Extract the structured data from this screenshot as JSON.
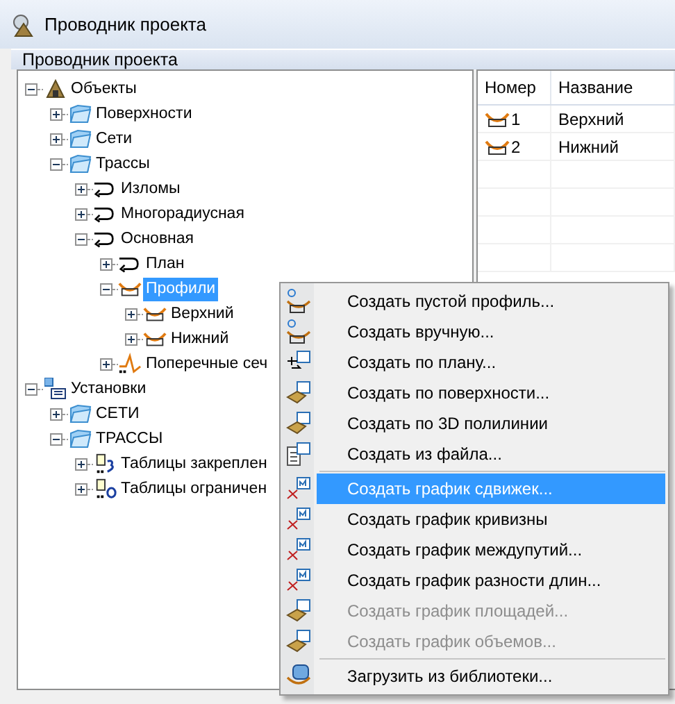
{
  "window": {
    "title": "Проводник проекта"
  },
  "panel_header": "Проводник проекта",
  "tree": [
    {
      "label": "Объекты",
      "kind": "root",
      "expanded": true,
      "selected": false,
      "children": [
        {
          "label": "Поверхности",
          "kind": "folder",
          "expanded": false,
          "selected": false
        },
        {
          "label": "Сети",
          "kind": "folder",
          "expanded": false,
          "selected": false
        },
        {
          "label": "Трассы",
          "kind": "folder",
          "expanded": true,
          "selected": false,
          "children": [
            {
              "label": "Изломы",
              "kind": "alignment",
              "expanded": false,
              "selected": false
            },
            {
              "label": "Многорадиусная",
              "kind": "alignment",
              "expanded": false,
              "selected": false
            },
            {
              "label": "Основная",
              "kind": "alignment",
              "expanded": true,
              "selected": false,
              "children": [
                {
                  "label": "План",
                  "kind": "alignment",
                  "expanded": false,
                  "selected": false
                },
                {
                  "label": "Профили",
                  "kind": "profile",
                  "expanded": true,
                  "selected": true,
                  "children": [
                    {
                      "label": "Верхний",
                      "kind": "profile",
                      "expanded": false,
                      "selected": false
                    },
                    {
                      "label": "Нижний",
                      "kind": "profile",
                      "expanded": false,
                      "selected": false
                    }
                  ]
                },
                {
                  "label": "Поперечные сеч",
                  "kind": "section",
                  "expanded": false,
                  "selected": false
                }
              ]
            }
          ]
        }
      ]
    },
    {
      "label": "Установки",
      "kind": "settings",
      "expanded": true,
      "selected": false,
      "children": [
        {
          "label": "СЕТИ",
          "kind": "folder",
          "expanded": false,
          "selected": false
        },
        {
          "label": "ТРАССЫ",
          "kind": "folder",
          "expanded": true,
          "selected": false,
          "children": [
            {
              "label": "Таблицы закреплен",
              "kind": "table3",
              "expanded": false,
              "selected": false
            },
            {
              "label": "Таблицы ограничен",
              "kind": "tableO",
              "expanded": false,
              "selected": false
            }
          ]
        }
      ]
    }
  ],
  "table": {
    "columns": [
      "Номер",
      "Название"
    ],
    "rows": [
      {
        "number": "1",
        "name": "Верхний"
      },
      {
        "number": "2",
        "name": "Нижний"
      }
    ]
  },
  "context_menu": [
    {
      "kind": "new",
      "label": "Создать пустой профиль...",
      "selected": false,
      "disabled": false
    },
    {
      "kind": "new",
      "label": "Создать вручную...",
      "selected": false,
      "disabled": false
    },
    {
      "kind": "arrow",
      "label": "Создать по плану...",
      "selected": false,
      "disabled": false
    },
    {
      "kind": "surface",
      "label": "Создать по поверхности...",
      "selected": false,
      "disabled": false
    },
    {
      "kind": "surface",
      "label": "Создать по 3D полилинии",
      "selected": false,
      "disabled": false
    },
    {
      "kind": "file",
      "label": "Создать из файла...",
      "selected": false,
      "disabled": false
    },
    {
      "kind": "separator"
    },
    {
      "kind": "chart",
      "label": "Создать график сдвижек...",
      "selected": true,
      "disabled": false
    },
    {
      "kind": "chart",
      "label": "Создать график кривизны",
      "selected": false,
      "disabled": false
    },
    {
      "kind": "chart",
      "label": "Создать график междупутий...",
      "selected": false,
      "disabled": false
    },
    {
      "kind": "chart",
      "label": "Создать график разности длин...",
      "selected": false,
      "disabled": false
    },
    {
      "kind": "surface",
      "label": "Создать график площадей...",
      "selected": false,
      "disabled": true
    },
    {
      "kind": "surface",
      "label": "Создать график объемов...",
      "selected": false,
      "disabled": true
    },
    {
      "kind": "separator"
    },
    {
      "kind": "library",
      "label": "Загрузить из библиотеки...",
      "selected": false,
      "disabled": false
    }
  ]
}
